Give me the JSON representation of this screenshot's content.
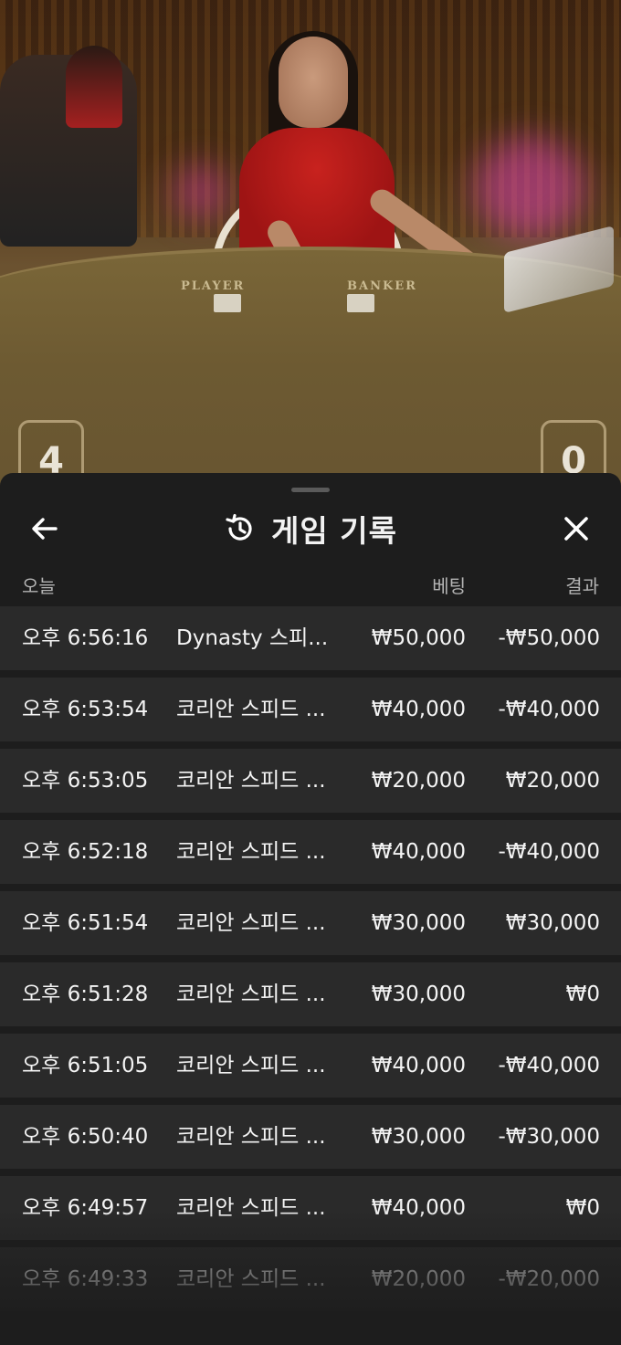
{
  "video": {
    "felt_player_label": "PLAYER",
    "felt_banker_label": "BANKER",
    "player_score": "4",
    "banker_score": "0"
  },
  "history": {
    "title": "게임 기록",
    "section_label": "오늘",
    "col_bet": "베팅",
    "col_result": "결과",
    "rows": [
      {
        "time": "오후 6:56:16",
        "game": "Dynasty 스피...",
        "bet": "₩50,000",
        "result": "-₩50,000"
      },
      {
        "time": "오후 6:53:54",
        "game": "코리안 스피드 ...",
        "bet": "₩40,000",
        "result": "-₩40,000"
      },
      {
        "time": "오후 6:53:05",
        "game": "코리안 스피드 ...",
        "bet": "₩20,000",
        "result": "₩20,000"
      },
      {
        "time": "오후 6:52:18",
        "game": "코리안 스피드 ...",
        "bet": "₩40,000",
        "result": "-₩40,000"
      },
      {
        "time": "오후 6:51:54",
        "game": "코리안 스피드 ...",
        "bet": "₩30,000",
        "result": "₩30,000"
      },
      {
        "time": "오후 6:51:28",
        "game": "코리안 스피드 ...",
        "bet": "₩30,000",
        "result": "₩0"
      },
      {
        "time": "오후 6:51:05",
        "game": "코리안 스피드 ...",
        "bet": "₩40,000",
        "result": "-₩40,000"
      },
      {
        "time": "오후 6:50:40",
        "game": "코리안 스피드 ...",
        "bet": "₩30,000",
        "result": "-₩30,000"
      },
      {
        "time": "오후 6:49:57",
        "game": "코리안 스피드 ...",
        "bet": "₩40,000",
        "result": "₩0"
      },
      {
        "time": "오후 6:49:33",
        "game": "코리안 스피드 ...",
        "bet": "₩20,000",
        "result": "-₩20,000"
      }
    ]
  },
  "colors": {
    "sheet_bg": "#1d1d1d",
    "row_bg": "#2a2a2a",
    "text": "#f4f4f4",
    "muted": "#b4b4b4"
  }
}
